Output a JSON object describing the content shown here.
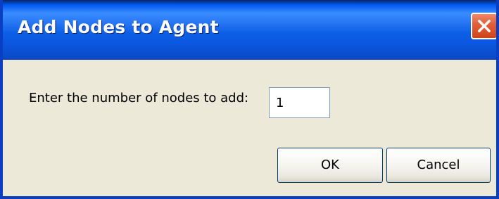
{
  "dialog": {
    "title": "Add Nodes to Agent",
    "prompt": "Enter the number of nodes to add:",
    "node_count_value": "1",
    "ok_label": "OK",
    "cancel_label": "Cancel",
    "close_icon": "close-icon"
  },
  "colors": {
    "titlebar": "#0a5fe6",
    "frame_border": "#0a3fc4",
    "dialog_background": "#ece9d8",
    "close_button": "#e2603a"
  }
}
